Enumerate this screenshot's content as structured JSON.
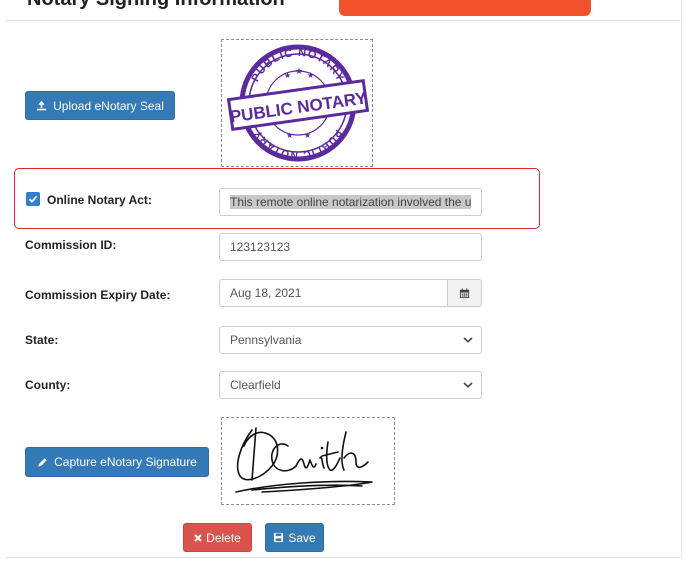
{
  "header": {
    "title": "Notary Signing Information",
    "accent_color": "#f0522b"
  },
  "seal": {
    "upload_label": "Upload eNotary Seal",
    "upload_icon": "upload-icon",
    "stamp_top": "PUBLIC NOTARY",
    "stamp_center": "PUBLIC NOTARY",
    "stamp_bottom": "PUBLIC NOTARY",
    "stamp_color": "#5b2a9c"
  },
  "online_act": {
    "label": "Online Notary Act:",
    "checked": true,
    "value": "This remote online notarization involved the u"
  },
  "commission_id": {
    "label": "Commission ID:",
    "value": "123123123"
  },
  "commission_expiry": {
    "label": "Commission Expiry Date:",
    "value": "Aug 18, 2021",
    "icon": "calendar-icon"
  },
  "state": {
    "label": "State:",
    "value": "Pennsylvania"
  },
  "county": {
    "label": "County:",
    "value": "Clearfield"
  },
  "signature": {
    "capture_label": "Capture eNotary Signature",
    "capture_icon": "pencil-icon",
    "signed_name": "P. Smith"
  },
  "actions": {
    "delete_label": "Delete",
    "save_label": "Save",
    "delete_color": "#d9534f",
    "save_color": "#337ab7"
  }
}
